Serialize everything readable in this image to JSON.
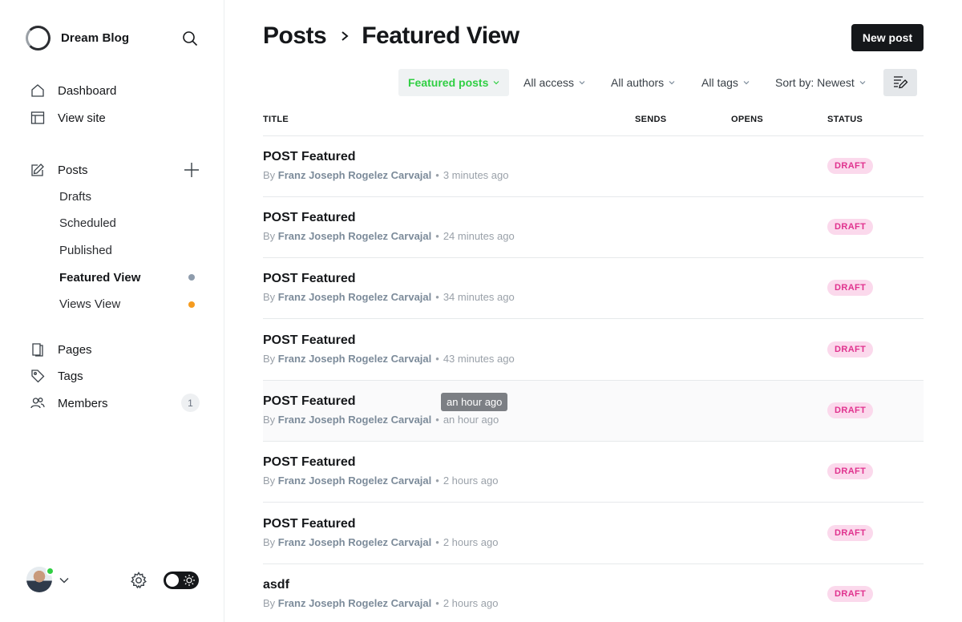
{
  "sidebar": {
    "brand": "Dream Blog",
    "nav": {
      "dashboard": "Dashboard",
      "view_site": "View site",
      "posts": "Posts",
      "pages": "Pages",
      "tags": "Tags",
      "members": "Members",
      "members_count": "1"
    },
    "post_views": {
      "drafts": "Drafts",
      "scheduled": "Scheduled",
      "published": "Published",
      "featured_view": "Featured View",
      "views_view": "Views View"
    },
    "colors": {
      "featured_dot": "#8e9cac",
      "views_dot": "#f59b1f",
      "online": "#30cf43"
    }
  },
  "header": {
    "breadcrumb_parent": "Posts",
    "breadcrumb_current": "Featured View",
    "new_post_label": "New post"
  },
  "filters": {
    "type": "Featured posts",
    "access": "All access",
    "authors": "All authors",
    "tags": "All tags",
    "sort": "Sort by: Newest"
  },
  "table": {
    "columns": [
      "TITLE",
      "SENDS",
      "OPENS",
      "STATUS"
    ],
    "rows": [
      {
        "title": "POST Featured",
        "by": "By",
        "author": "Franz Joseph Rogelez Carvajal",
        "time": "3 minutes ago",
        "status": "DRAFT"
      },
      {
        "title": "POST Featured",
        "by": "By",
        "author": "Franz Joseph Rogelez Carvajal",
        "time": "24 minutes ago",
        "status": "DRAFT"
      },
      {
        "title": "POST Featured",
        "by": "By",
        "author": "Franz Joseph Rogelez Carvajal",
        "time": "34 minutes ago",
        "status": "DRAFT"
      },
      {
        "title": "POST Featured",
        "by": "By",
        "author": "Franz Joseph Rogelez Carvajal",
        "time": "43 minutes ago",
        "status": "DRAFT"
      },
      {
        "title": "POST Featured",
        "by": "By",
        "author": "Franz Joseph Rogelez Carvajal",
        "time": "an hour ago",
        "status": "DRAFT"
      },
      {
        "title": "POST Featured",
        "by": "By",
        "author": "Franz Joseph Rogelez Carvajal",
        "time": "2 hours ago",
        "status": "DRAFT"
      },
      {
        "title": "POST Featured",
        "by": "By",
        "author": "Franz Joseph Rogelez Carvajal",
        "time": "2 hours ago",
        "status": "DRAFT"
      },
      {
        "title": "asdf",
        "by": "By",
        "author": "Franz Joseph Rogelez Carvajal",
        "time": "2 hours ago",
        "status": "DRAFT"
      }
    ]
  },
  "tooltip": "an hour ago"
}
